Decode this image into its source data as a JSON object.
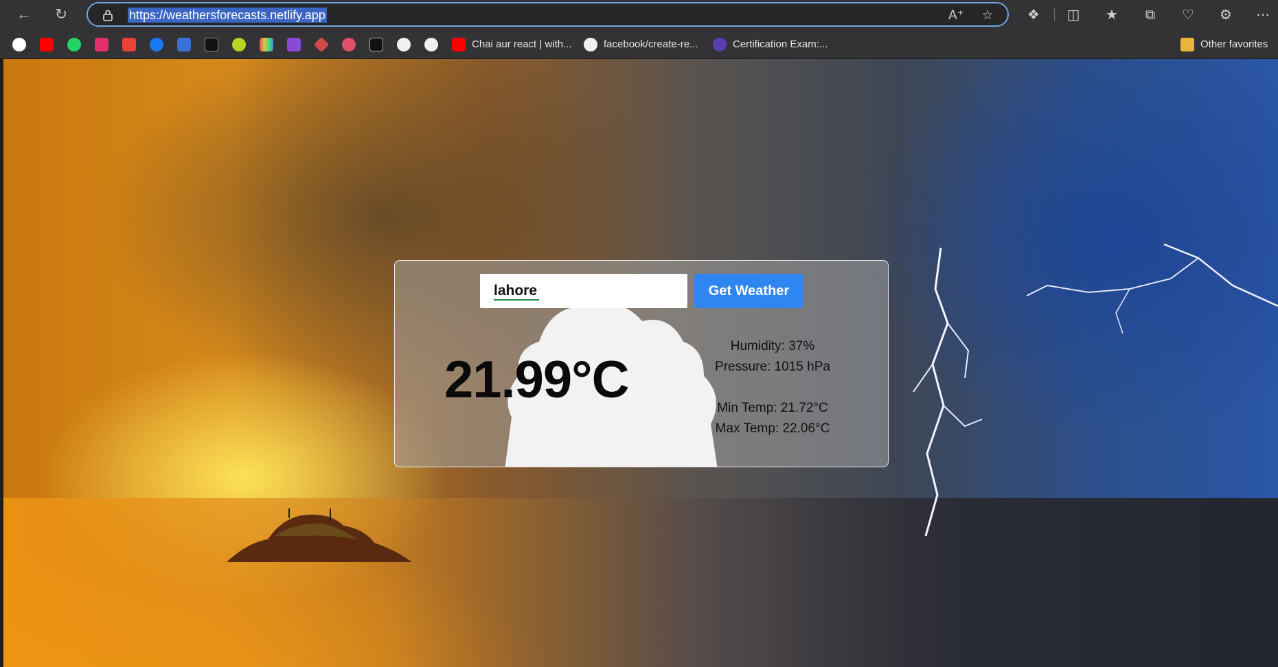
{
  "browser": {
    "url": "https://weathersforecasts.netlify.app",
    "bookmarks": [
      {
        "icon": "google-icon",
        "color": "#ea4335"
      },
      {
        "icon": "youtube-icon",
        "color": "#ff0000"
      },
      {
        "icon": "whatsapp-icon",
        "color": "#25d366"
      },
      {
        "icon": "instagram-icon",
        "color": "#e1306c"
      },
      {
        "icon": "gmail-icon",
        "color": "#ea4335"
      },
      {
        "icon": "facebook-icon",
        "color": "#1877f2"
      },
      {
        "icon": "blue-app-icon",
        "color": "#3a6fd8"
      },
      {
        "icon": "adobe-icon",
        "color": "#111111"
      },
      {
        "icon": "green-ball-icon",
        "color": "#b8d420"
      },
      {
        "icon": "colorbars-icon",
        "color": "#d9a53a"
      },
      {
        "icon": "purple-tv-icon",
        "color": "#8a4ad8"
      },
      {
        "icon": "diamond-icon",
        "color": "#d04a4a"
      },
      {
        "icon": "mask-icon",
        "color": "#e0506a"
      },
      {
        "icon": "medium-icon",
        "color": "#111111"
      },
      {
        "icon": "github-icon",
        "color": "#111111"
      },
      {
        "icon": "github-icon",
        "color": "#111111"
      }
    ],
    "named_bookmarks": [
      {
        "label": "Chai aur react | with...",
        "icon": "youtube-icon"
      },
      {
        "label": "facebook/create-re...",
        "icon": "github-icon"
      },
      {
        "label": "Certification Exam:...",
        "icon": "crescent-icon"
      }
    ],
    "other_favorites": "Other favorites"
  },
  "weather": {
    "city_value": "lahore",
    "button_label": "Get Weather",
    "temperature": "21.99°C",
    "humidity": "Humidity: 37%",
    "pressure": "Pressure: 1015 hPa",
    "min_temp": "Min Temp: 21.72°C",
    "max_temp": "Max Temp: 22.06°C"
  }
}
